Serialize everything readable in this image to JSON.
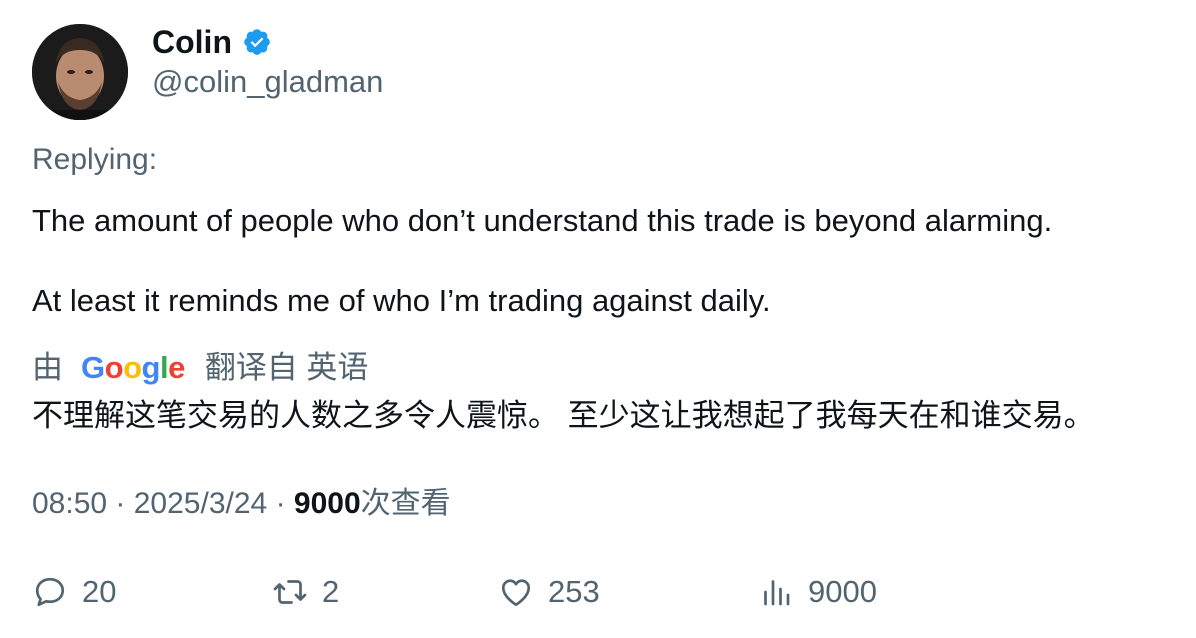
{
  "author": {
    "name": "Colin",
    "handle": "@colin_gladman",
    "verified_color": "#1d9bf0"
  },
  "replying_label": "Replying:",
  "tweet": {
    "line1": "The amount of people who don’t understand this trade is beyond alarming.",
    "line2": "At least it reminds me of who I’m trading against daily."
  },
  "translation": {
    "by_label": "由",
    "provider": "Google",
    "translated_from": "翻译自 英语",
    "text": "不理解这笔交易的人数之多令人震惊。 至少这让我想起了我每天在和谁交易。"
  },
  "meta": {
    "time": "08:50",
    "separator": "·",
    "date": "2025/3/24",
    "views_count": "9000",
    "views_label": "次查看"
  },
  "actions": {
    "replies": "20",
    "retweets": "2",
    "likes": "253",
    "views": "9000"
  }
}
